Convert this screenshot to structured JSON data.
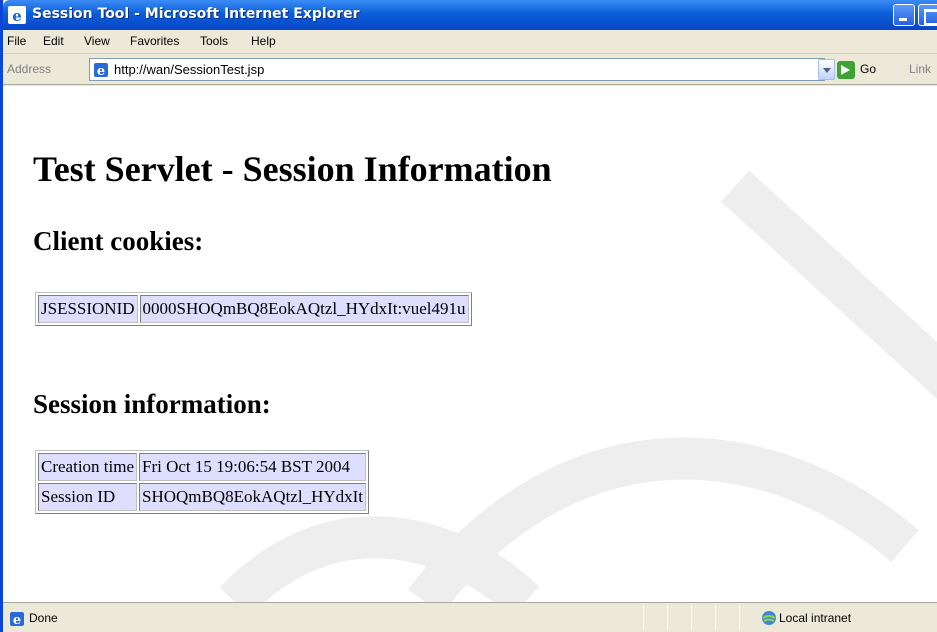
{
  "window": {
    "title": "Session Tool - Microsoft Internet Explorer"
  },
  "menu": {
    "items": [
      "File",
      "Edit",
      "View",
      "Favorites",
      "Tools",
      "Help"
    ]
  },
  "address_bar": {
    "label": "Address",
    "url": "http://wan/SessionTest.jsp",
    "go_label": "Go",
    "links_label": "Link"
  },
  "page": {
    "title": "Test Servlet - Session Information",
    "cookies_heading": "Client cookies:",
    "cookies": [
      {
        "name": "JSESSIONID",
        "value": "0000SHOQmBQ8EokAQtzl_HYdxIt:vuel491u"
      }
    ],
    "session_heading": "Session information:",
    "session": [
      {
        "name": "Creation time",
        "value": "Fri Oct 15 19:06:54 BST 2004"
      },
      {
        "name": "Session ID",
        "value": "SHOQmBQ8EokAQtzl_HYdxIt"
      }
    ]
  },
  "status_bar": {
    "text": "Done",
    "zone": "Local intranet"
  },
  "colors": {
    "titlebar": "#0a5fd8",
    "table_cell_bg": "#dedefe",
    "watermark": "#eeeeee"
  },
  "icons": {
    "title": "ie-icon",
    "address": "ie-page-icon",
    "go": "go-arrow-icon",
    "status": "ie-page-icon",
    "zone": "local-intranet-icon"
  }
}
